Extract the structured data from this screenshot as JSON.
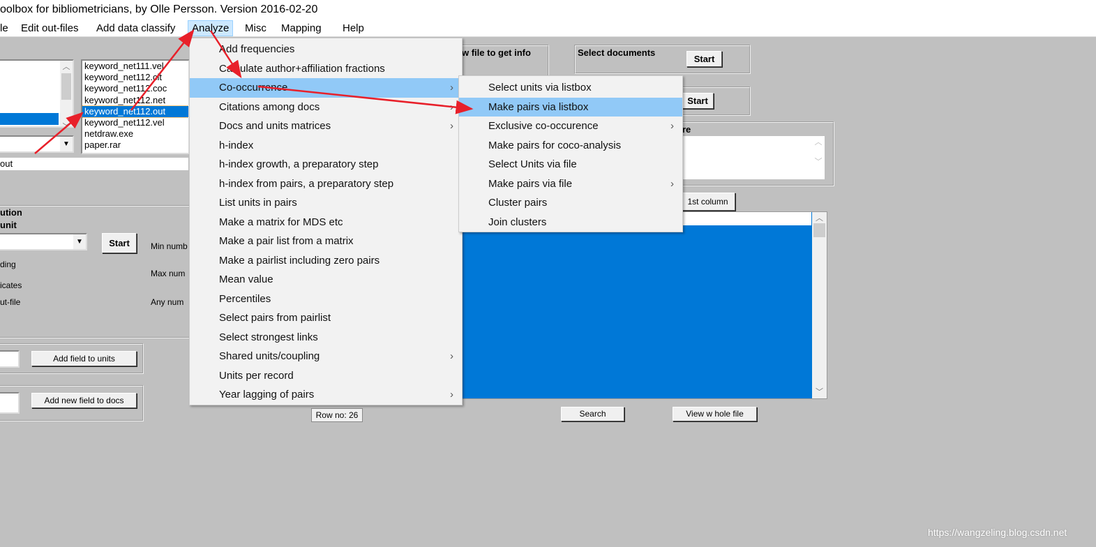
{
  "title": "oolbox for bibliometricians, by Olle Persson. Version 2016-02-20",
  "menubar": [
    "le",
    "Edit out-files",
    "Add data classify",
    "Analyze",
    "Misc",
    "Mapping",
    "Help"
  ],
  "analyze_menu": [
    {
      "label": "Add frequencies"
    },
    {
      "label": "Calculate author+affiliation fractions"
    },
    {
      "label": "Co-occurrence",
      "submenu": true,
      "highlighted": true
    },
    {
      "label": "Citations among docs",
      "submenu": true
    },
    {
      "label": "Docs and units matrices",
      "submenu": true
    },
    {
      "label": "h-index"
    },
    {
      "label": "h-index growth, a preparatory step"
    },
    {
      "label": "h-index from pairs, a preparatory step"
    },
    {
      "label": "List units in pairs"
    },
    {
      "label": "Make a matrix for MDS etc"
    },
    {
      "label": "Make a pair list from a matrix"
    },
    {
      "label": "Make a pairlist including zero pairs"
    },
    {
      "label": "Mean value"
    },
    {
      "label": "Percentiles"
    },
    {
      "label": "Select pairs from pairlist"
    },
    {
      "label": "Select strongest links"
    },
    {
      "label": "Shared units/coupling",
      "submenu": true
    },
    {
      "label": "Units per record"
    },
    {
      "label": "Year lagging of pairs",
      "submenu": true
    }
  ],
  "cooccurrence_submenu": [
    {
      "label": "Select units via listbox"
    },
    {
      "label": "Make pairs via listbox",
      "highlighted": true
    },
    {
      "label": "Exclusive co-occurence",
      "submenu": true
    },
    {
      "label": "Make pairs for coco-analysis"
    },
    {
      "label": "Select Units via file"
    },
    {
      "label": "Make pairs via file",
      "submenu": true
    },
    {
      "label": "Cluster pairs"
    },
    {
      "label": "Join clusters"
    }
  ],
  "files": [
    "keyword_net111.vel",
    "keyword_net112.cit",
    "keyword_net112.coc",
    "keyword_net112.net",
    "keyword_net112.out",
    "keyword_net112.vel",
    "netdraw.exe",
    "paper.rar"
  ],
  "selected_file": "keyword_net112.out",
  "filename_field": "out",
  "distribution": {
    "title1": "ution",
    "title2": "unit",
    "start": "Start",
    "opt1": "ding",
    "opt2": "icates",
    "opt3": "ut-file",
    "min": "Min numb",
    "max": "Max num",
    "any": "Any num"
  },
  "add_field_units": "Add field to units",
  "add_field_docs": "Add new field to docs",
  "file_info": {
    "title": "w file to get info",
    "sub": "."
  },
  "select_documents": {
    "title": "Select documents",
    "start": "Start"
  },
  "second_start": "Start",
  "textarea_label": "re",
  "first_column": "1st column",
  "row_no": "Row  no: 26",
  "search": "Search",
  "view_whole_file": "View  w hole file",
  "watermark": "https://wangzeling.blog.csdn.net",
  "colors": {
    "menu_highlight": "#91c9f7",
    "selection": "#0078d7",
    "arrow": "#e8202a"
  }
}
